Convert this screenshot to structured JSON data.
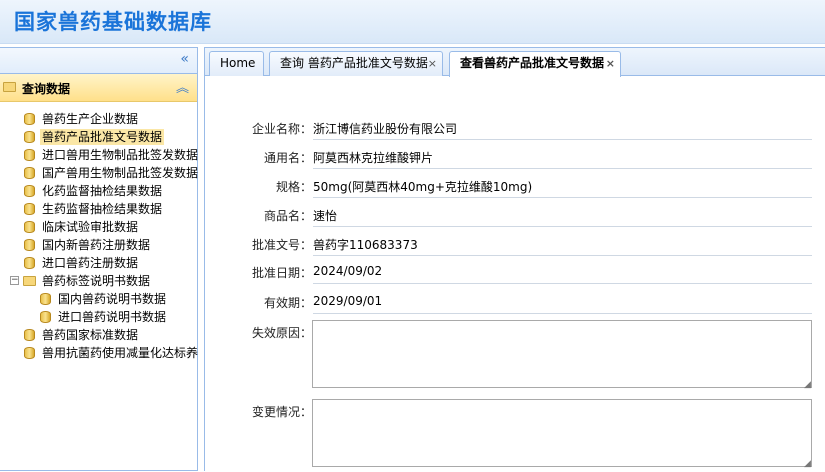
{
  "header": {
    "title": "国家兽药基础数据库"
  },
  "sidebar": {
    "collapse_icon": "«",
    "section_title": "查询数据",
    "expand_icon": "︽",
    "items": [
      {
        "label": "兽药生产企业数据"
      },
      {
        "label": "兽药产品批准文号数据"
      },
      {
        "label": "进口兽用生物制品批签发数据"
      },
      {
        "label": "国产兽用生物制品批签发数据"
      },
      {
        "label": "化药监督抽检结果数据"
      },
      {
        "label": "生药监督抽检结果数据"
      },
      {
        "label": "临床试验审批数据"
      },
      {
        "label": "国内新兽药注册数据"
      },
      {
        "label": "进口兽药注册数据"
      },
      {
        "label": "兽药标签说明书数据"
      },
      {
        "label": "国内兽药说明书数据"
      },
      {
        "label": "进口兽药说明书数据"
      },
      {
        "label": "兽药国家标准数据"
      },
      {
        "label": "兽用抗菌药使用减量化达标养"
      }
    ],
    "selected": "兽药产品批准文号数据"
  },
  "tabs": [
    {
      "label": "Home",
      "closable": false
    },
    {
      "label": "查询 兽药产品批准文号数据",
      "closable": true
    },
    {
      "label": "查看兽药产品批准文号数据",
      "closable": true,
      "active": true
    }
  ],
  "close_glyph": "×",
  "form": {
    "fields": [
      {
        "label": "企业名称：",
        "value": "浙江博信药业股份有限公司"
      },
      {
        "label": "通用名：",
        "value": "阿莫西林克拉维酸钾片"
      },
      {
        "label": "规格：",
        "value": "50mg(阿莫西林40mg+克拉维酸10mg)"
      },
      {
        "label": "商品名：",
        "value": "速怡"
      },
      {
        "label": "批准文号：",
        "value": "兽药字110683373"
      },
      {
        "label": "批准日期：",
        "value": "2024/09/02"
      },
      {
        "label": "有效期：",
        "value": "2029/09/01"
      }
    ],
    "invalid_reason_label": "失效原因：",
    "invalid_reason_value": "",
    "change_label": "变更情况：",
    "change_value": ""
  }
}
